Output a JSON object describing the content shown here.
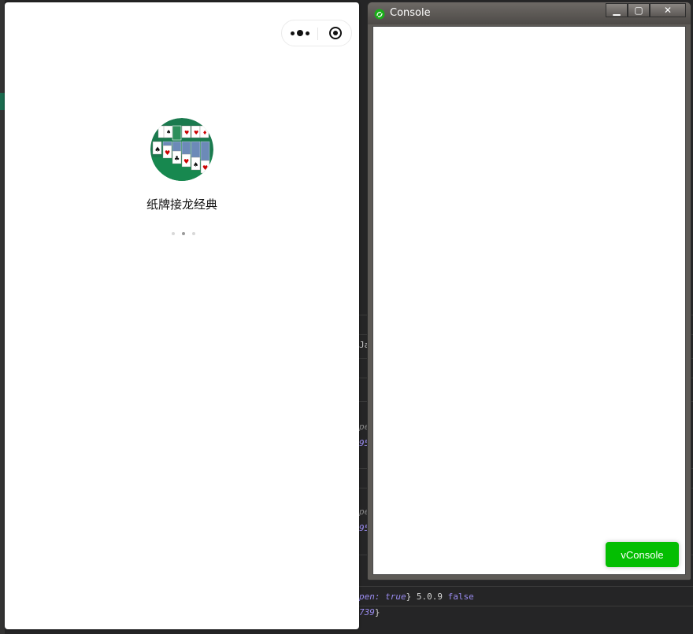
{
  "simulator": {
    "app_name": "纸牌接龙经典",
    "capsule": {
      "more_icon": "more-dots-icon",
      "close_icon": "target-close-icon"
    },
    "loading_dots": 3,
    "logo": {
      "icon": "solitaire-cards-icon",
      "accent": "#1a7a4e"
    }
  },
  "console_window": {
    "title": "Console",
    "controls": {
      "minimize": "▁",
      "maximize": "▢",
      "close": "✕"
    },
    "vconsole_label": "vConsole",
    "vconsole_color": "#04be02"
  },
  "ide_background": {
    "lines": [
      {
        "text": "Ja"
      },
      {
        "text": "pe"
      },
      {
        "text": "95"
      },
      {
        "text": "pe"
      },
      {
        "text": "95"
      },
      {
        "a": "pen: ",
        "b": "true",
        "c": "} 5.0.9 ",
        "d": "false"
      },
      {
        "a": "",
        "b": "739",
        "c": "}",
        "d": ""
      }
    ]
  }
}
